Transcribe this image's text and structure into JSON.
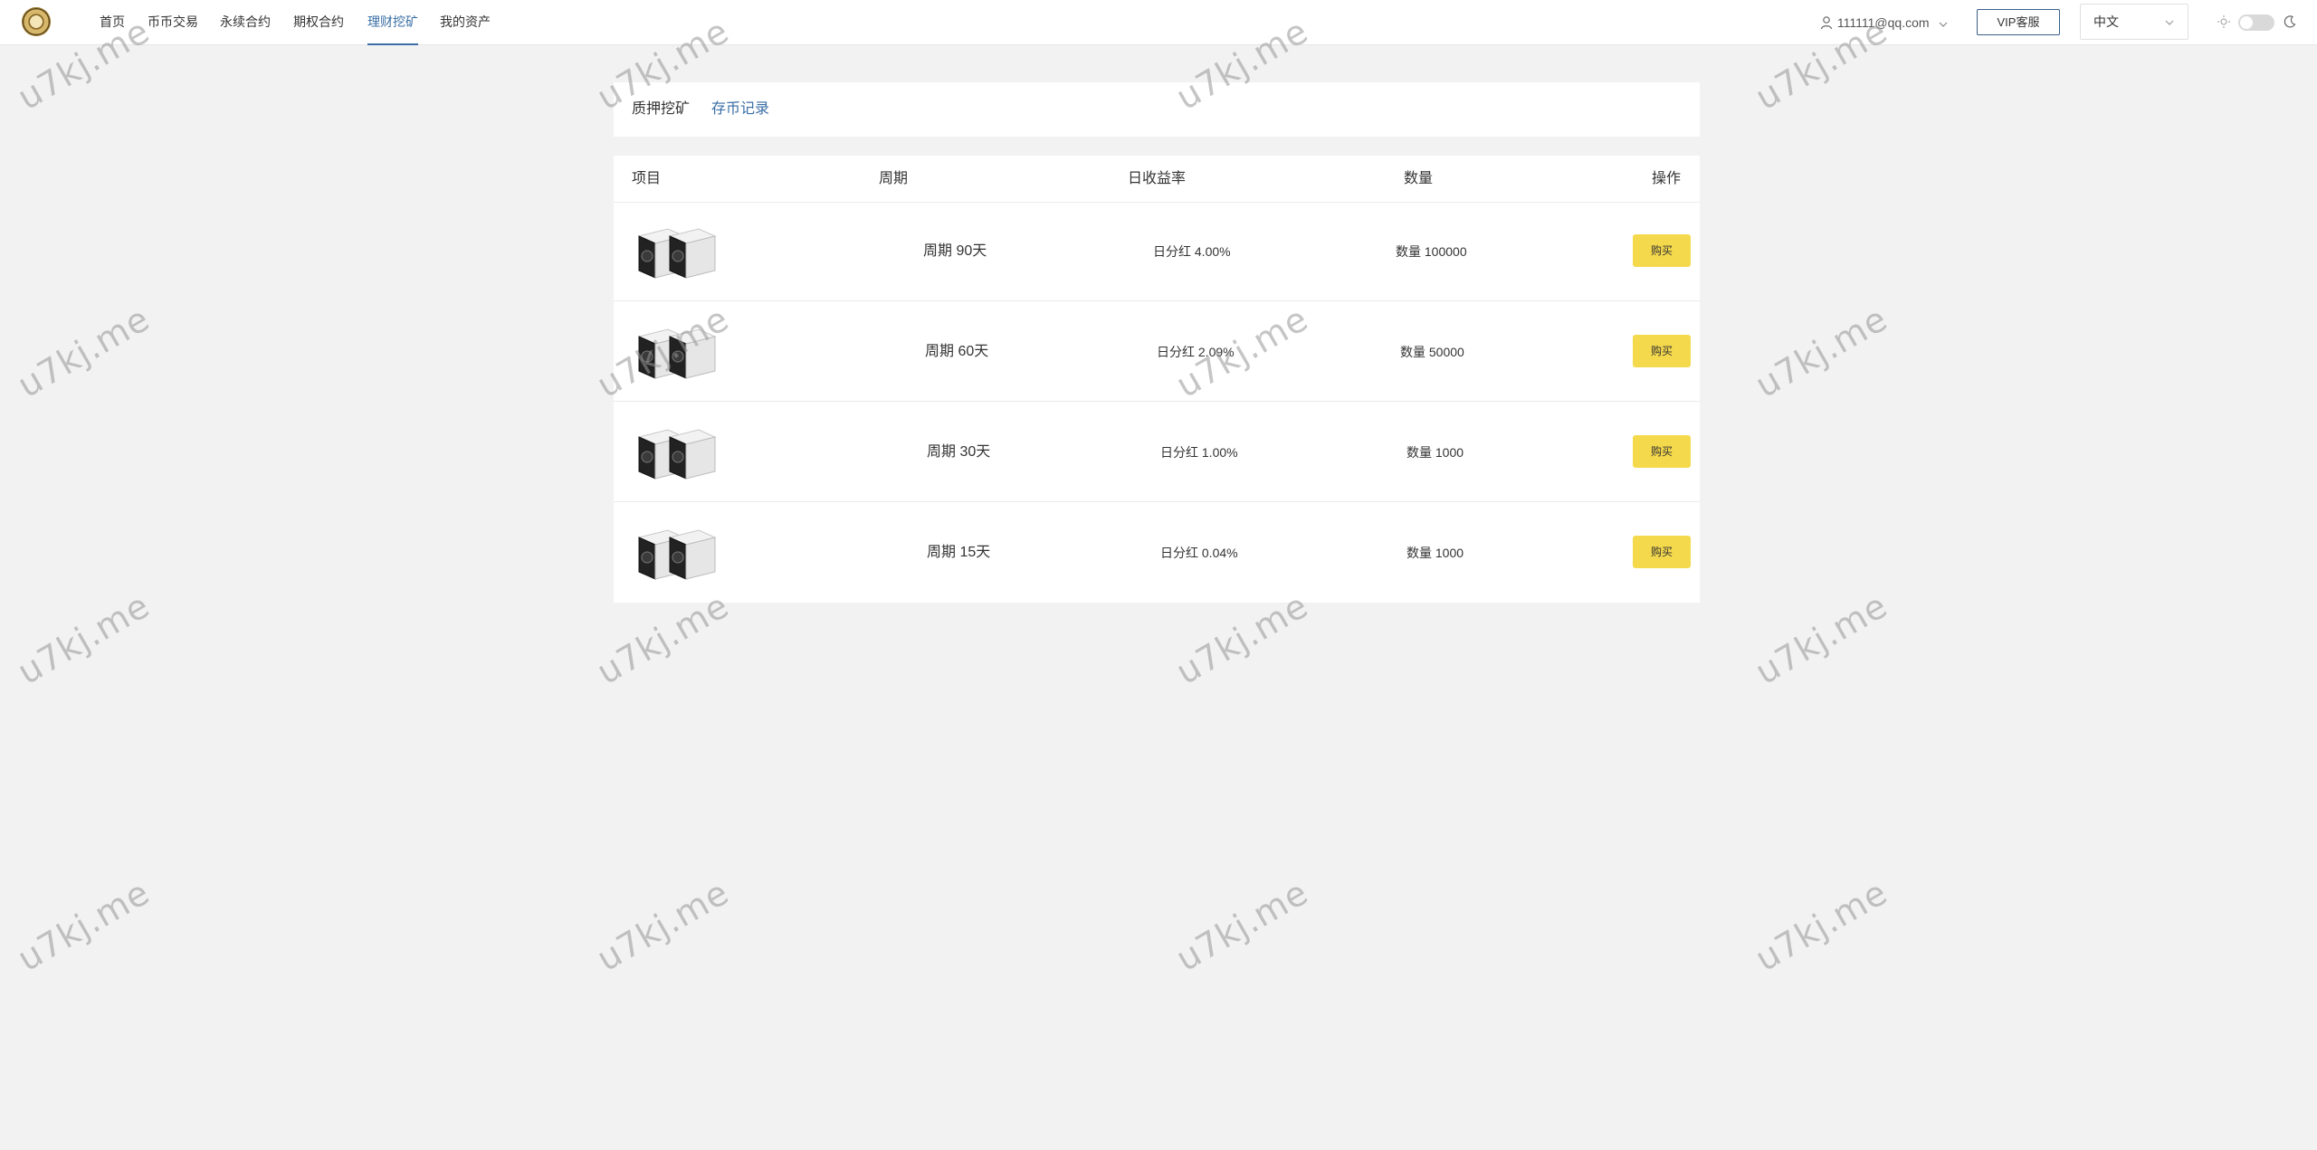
{
  "nav": {
    "items": [
      {
        "label": "首页",
        "active": false
      },
      {
        "label": "币币交易",
        "active": false
      },
      {
        "label": "永续合约",
        "active": false
      },
      {
        "label": "期权合约",
        "active": false
      },
      {
        "label": "理财挖矿",
        "active": true
      },
      {
        "label": "我的资产",
        "active": false
      }
    ],
    "user_email": "111111@qq.com",
    "vip_label": "VIP客服",
    "language": "中文"
  },
  "tabs": [
    {
      "label": "质押挖矿",
      "active": false
    },
    {
      "label": "存币记录",
      "active": true
    }
  ],
  "table": {
    "headers": [
      "项目",
      "周期",
      "日收益率",
      "数量",
      "操作"
    ],
    "rows": [
      {
        "period": "周期 90天",
        "rate": "日分红 4.00%",
        "qty": "数量 100000",
        "action": "购买"
      },
      {
        "period": "周期 60天",
        "rate": "日分红 2.09%",
        "qty": "数量 50000",
        "action": "购买"
      },
      {
        "period": "周期 30天",
        "rate": "日分红 1.00%",
        "qty": "数量 1000",
        "action": "购买"
      },
      {
        "period": "周期 15天",
        "rate": "日分红 0.04%",
        "qty": "数量 1000",
        "action": "购买"
      }
    ]
  },
  "watermark": "u7kj.me",
  "colors": {
    "accent": "#3a6ea5",
    "buy_button": "#f5d94c",
    "page_bg": "#f2f2f2"
  }
}
